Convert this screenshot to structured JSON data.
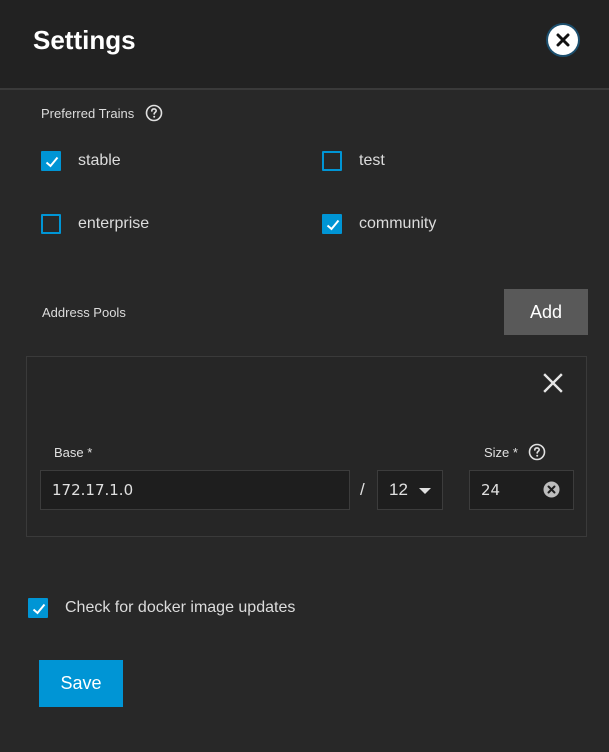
{
  "header": {
    "title": "Settings"
  },
  "preferred_trains": {
    "label": "Preferred Trains",
    "options": [
      {
        "label": "stable",
        "checked": true
      },
      {
        "label": "test",
        "checked": false
      },
      {
        "label": "enterprise",
        "checked": false
      },
      {
        "label": "community",
        "checked": true
      }
    ]
  },
  "address_pools": {
    "label": "Address Pools",
    "add_label": "Add",
    "pool": {
      "base_label": "Base *",
      "base_value": "172.17.1.0",
      "separator": "/",
      "prefix_value": "12",
      "size_label": "Size *",
      "size_value": "24"
    }
  },
  "docker_updates": {
    "label": "Check for docker image updates",
    "checked": true
  },
  "actions": {
    "save_label": "Save"
  },
  "icons": {
    "close": "close-icon",
    "help": "help-icon",
    "remove": "close-icon",
    "clear": "clear-circle-icon",
    "dropdown": "caret-down-icon",
    "check": "check-icon"
  },
  "colors": {
    "accent": "#0095d5",
    "background": "#282828",
    "header": "#222222",
    "add_button": "#595959"
  }
}
